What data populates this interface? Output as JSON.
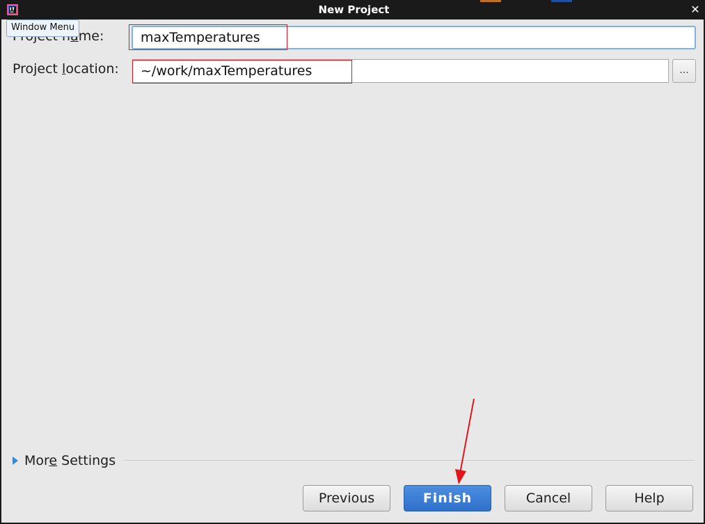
{
  "window": {
    "title": "New Project",
    "tooltip": "Window Menu"
  },
  "form": {
    "project_name": {
      "label_pre": "Project n",
      "label_mnemonic": "a",
      "label_post": "me:",
      "value": "maxTemperatures"
    },
    "project_location": {
      "label_pre": "Project ",
      "label_mnemonic": "l",
      "label_post": "ocation:",
      "value": "~/work/maxTemperatures",
      "browse_label": "..."
    }
  },
  "more_settings": {
    "label_pre": "Mor",
    "label_mnemonic": "e",
    "label_post": " Settings",
    "expanded": false
  },
  "buttons": {
    "previous": "Previous",
    "finish": "Finish",
    "cancel": "Cancel",
    "help": "Help"
  },
  "colors": {
    "annotation": "#e0161c",
    "accent": "#3d88c8",
    "primary_button": "#2f70cc"
  },
  "icons": {
    "app": "intellij-idea-icon",
    "close": "close-icon",
    "expand": "triangle-right-icon"
  }
}
